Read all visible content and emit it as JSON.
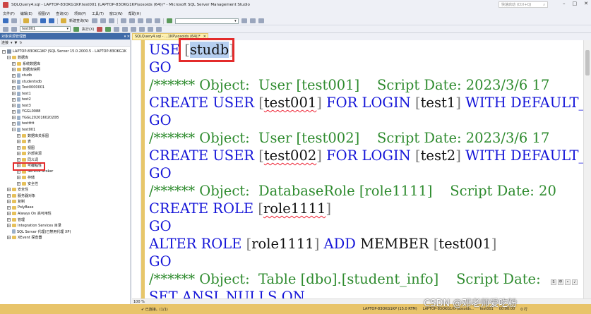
{
  "window": {
    "title": "SQLQuery4.sql - LAPTOP-83OKG1KP.test001 (LAPTOP-83OKG1KP\\sosoids (64))* - Microsoft SQL Server Management Studio",
    "quick_launch": "快速启动 (Ctrl+Q)"
  },
  "menu": [
    "文件(F)",
    "编辑(E)",
    "视图(V)",
    "查询(Q)",
    "项目(P)",
    "工具(T)",
    "窗口(W)",
    "帮助(H)"
  ],
  "toolbar": {
    "new_query": "新建查询(N)",
    "db_combo": "test001",
    "execute": "执行(X)"
  },
  "object_explorer": {
    "header": "对象资源管理器",
    "connect": "连接",
    "tree": [
      {
        "level": 0,
        "exp": "⊟",
        "icon": "server",
        "label": "LAPTOP-83OKG1KP (SQL Server 15.0.2000.5 - LAPTOP-83OKG1K"
      },
      {
        "level": 1,
        "exp": "⊟",
        "icon": "folder",
        "label": "数据库"
      },
      {
        "level": 2,
        "exp": "⊞",
        "icon": "folder",
        "label": "系统数据库"
      },
      {
        "level": 2,
        "exp": "⊞",
        "icon": "folder",
        "label": "数据库快照"
      },
      {
        "level": 2,
        "exp": "⊞",
        "icon": "db",
        "label": "studb"
      },
      {
        "level": 2,
        "exp": "⊞",
        "icon": "db",
        "label": "studentsdb"
      },
      {
        "level": 2,
        "exp": "⊞",
        "icon": "db",
        "label": "Test0000001"
      },
      {
        "level": 2,
        "exp": "⊞",
        "icon": "db",
        "label": "test1"
      },
      {
        "level": 2,
        "exp": "⊞",
        "icon": "db",
        "label": "test2"
      },
      {
        "level": 2,
        "exp": "⊞",
        "icon": "db",
        "label": "test3"
      },
      {
        "level": 2,
        "exp": "⊞",
        "icon": "db",
        "label": "YGGL0088"
      },
      {
        "level": 2,
        "exp": "⊞",
        "icon": "db",
        "label": "YGGL20201602020B"
      },
      {
        "level": 2,
        "exp": "⊞",
        "icon": "db",
        "label": "testtttt"
      },
      {
        "level": 2,
        "exp": "⊟",
        "icon": "db",
        "label": "test001"
      },
      {
        "level": 3,
        "exp": "⊞",
        "icon": "folder",
        "label": "数据库关系图"
      },
      {
        "level": 3,
        "exp": "⊞",
        "icon": "folder",
        "label": "表"
      },
      {
        "level": 3,
        "exp": "⊞",
        "icon": "folder",
        "label": "视图"
      },
      {
        "level": 3,
        "exp": "⊞",
        "icon": "folder",
        "label": "外部资源"
      },
      {
        "level": 3,
        "exp": "⊞",
        "icon": "folder",
        "label": "同义词"
      },
      {
        "level": 3,
        "exp": "⊞",
        "icon": "folder",
        "label": "可编程性"
      },
      {
        "level": 3,
        "exp": "⊞",
        "icon": "folder",
        "label": "Service Broker"
      },
      {
        "level": 3,
        "exp": "⊞",
        "icon": "folder",
        "label": "存储"
      },
      {
        "level": 3,
        "exp": "⊞",
        "icon": "folder",
        "label": "安全性"
      },
      {
        "level": 1,
        "exp": "⊞",
        "icon": "folder",
        "label": "安全性"
      },
      {
        "level": 1,
        "exp": "⊞",
        "icon": "folder",
        "label": "服务器对象"
      },
      {
        "level": 1,
        "exp": "⊞",
        "icon": "folder",
        "label": "复制"
      },
      {
        "level": 1,
        "exp": "⊞",
        "icon": "folder",
        "label": "PolyBase"
      },
      {
        "level": 1,
        "exp": "⊞",
        "icon": "folder",
        "label": "Always On 高可用性"
      },
      {
        "level": 1,
        "exp": "⊞",
        "icon": "folder",
        "label": "管理"
      },
      {
        "level": 1,
        "exp": "⊞",
        "icon": "folder",
        "label": "Integration Services 目录"
      },
      {
        "level": 1,
        "exp": "",
        "icon": "db",
        "label": "SQL Server 代理(已禁用代理 XP)"
      },
      {
        "level": 1,
        "exp": "⊞",
        "icon": "folder",
        "label": "XEvent 探查器"
      }
    ]
  },
  "editor": {
    "tab_label": "SQLQuery4.sql - ...1KP\\sosoids (64))*",
    "lines": [
      [
        [
          "kw",
          "USE "
        ],
        [
          "gr",
          "["
        ],
        [
          "sel",
          "studb"
        ],
        [
          "gr",
          "]"
        ]
      ],
      [
        [
          "kw",
          "GO"
        ]
      ],
      [
        [
          "cm",
          "/****** Object:  User [test001]    Script Date: 2023/3/6 17"
        ]
      ],
      [
        [
          "kw",
          "CREATE USER "
        ],
        [
          "gr",
          "["
        ],
        [
          "ul",
          "test001"
        ],
        [
          "gr",
          "]"
        ],
        [
          "kw",
          " FOR LOGIN "
        ],
        [
          "gr",
          "["
        ],
        [
          "pl",
          "test1"
        ],
        [
          "gr",
          "]"
        ],
        [
          "kw",
          " WITH DEFAULT_SCHEMA"
        ]
      ],
      [
        [
          "kw",
          "GO"
        ]
      ],
      [
        [
          "cm",
          "/****** Object:  User [test002]    Script Date: 2023/3/6 17"
        ]
      ],
      [
        [
          "kw",
          "CREATE USER "
        ],
        [
          "gr",
          "["
        ],
        [
          "ul",
          "test002"
        ],
        [
          "gr",
          "]"
        ],
        [
          "kw",
          " FOR LOGIN "
        ],
        [
          "gr",
          "["
        ],
        [
          "pl",
          "test2"
        ],
        [
          "gr",
          "]"
        ],
        [
          "kw",
          " WITH DEFAULT_SCHEMA"
        ]
      ],
      [
        [
          "kw",
          "GO"
        ]
      ],
      [
        [
          "cm",
          "/****** Object:  DatabaseRole [role1111]    Script Date: 20"
        ]
      ],
      [
        [
          "kw",
          "CREATE ROLE "
        ],
        [
          "gr",
          "["
        ],
        [
          "ul",
          "role1111"
        ],
        [
          "gr",
          "]"
        ]
      ],
      [
        [
          "kw",
          "GO"
        ]
      ],
      [
        [
          "kw",
          "ALTER ROLE "
        ],
        [
          "gr",
          "["
        ],
        [
          "pl",
          "role1111"
        ],
        [
          "gr",
          "]"
        ],
        [
          "kw",
          " ADD "
        ],
        [
          "pl",
          "MEMBER "
        ],
        [
          "gr",
          "["
        ],
        [
          "pl",
          "test001"
        ],
        [
          "gr",
          "]"
        ]
      ],
      [
        [
          "kw",
          "GO"
        ]
      ],
      [
        [
          "cm",
          "/****** Object:  Table [dbo].[student_info]    Script Date:"
        ]
      ],
      [
        [
          "kw",
          "SET ANSI_NULLS ON"
        ]
      ]
    ]
  },
  "zoom": "100 %",
  "status": {
    "ok": "已连接。(1/1)",
    "server": "LAPTOP-83OKG1KP (15.0 RTM)",
    "user": "LAPTOP-83OKG1KP\\sosoids...",
    "db": "test001",
    "time": "00:00:00",
    "rows": "0 行"
  },
  "watermark": "CSDN @邓老师爱吃粉"
}
